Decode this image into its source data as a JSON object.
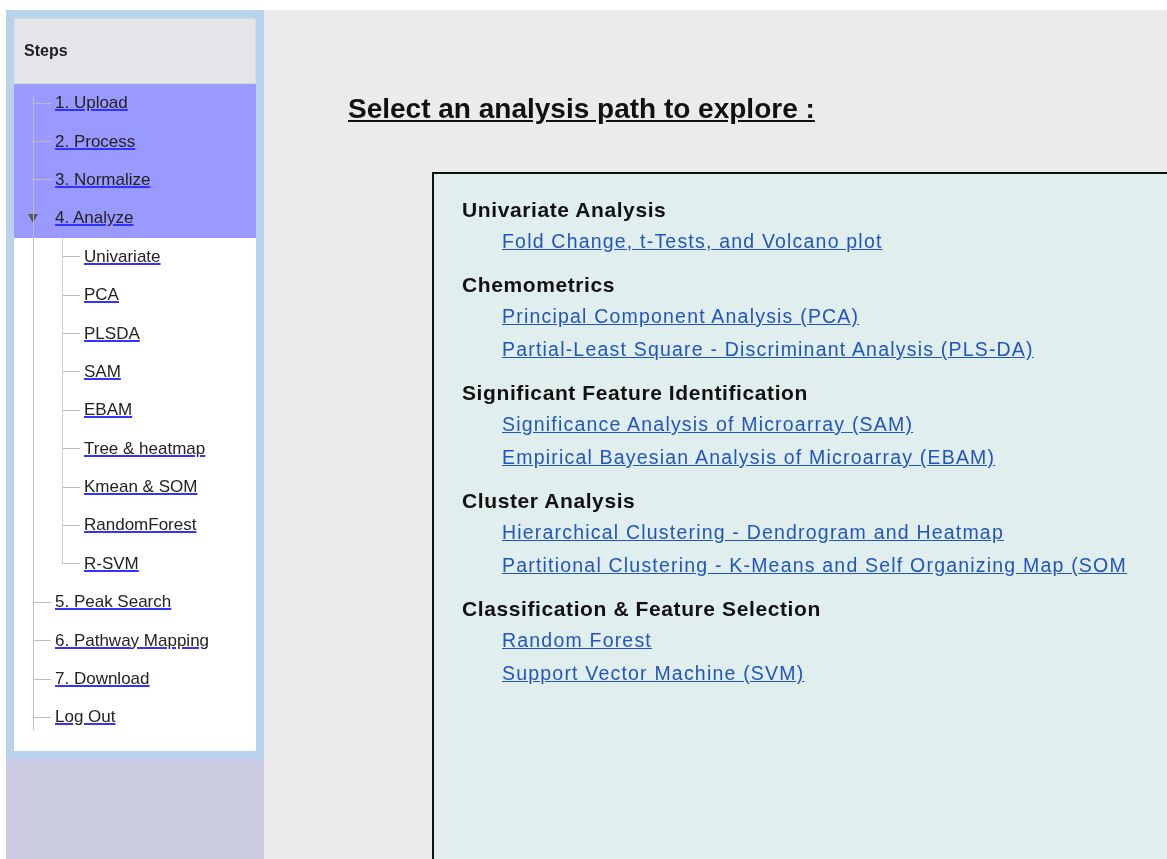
{
  "sidebar": {
    "title": "Steps",
    "items": [
      {
        "label": "1. Upload",
        "highlighted": true
      },
      {
        "label": "2. Process",
        "highlighted": true
      },
      {
        "label": "3. Normalize",
        "highlighted": true
      },
      {
        "label": "4. Analyze",
        "highlighted": true,
        "expanded": true,
        "children": [
          {
            "label": "Univariate"
          },
          {
            "label": "PCA"
          },
          {
            "label": "PLSDA"
          },
          {
            "label": "SAM"
          },
          {
            "label": "EBAM"
          },
          {
            "label": "Tree & heatmap"
          },
          {
            "label": "Kmean & SOM"
          },
          {
            "label": "RandomForest"
          },
          {
            "label": "R-SVM"
          }
        ]
      },
      {
        "label": "5. Peak Search",
        "highlighted": false
      },
      {
        "label": "6. Pathway Mapping",
        "highlighted": false
      },
      {
        "label": "7. Download",
        "highlighted": false
      },
      {
        "label": "Log Out",
        "highlighted": false
      }
    ]
  },
  "main": {
    "heading": "Select an analysis path to explore :",
    "sections": [
      {
        "title": "Univariate Analysis",
        "links": [
          "Fold Change, t-Tests, and Volcano plot"
        ]
      },
      {
        "title": "Chemometrics",
        "links": [
          "Principal Component Analysis (PCA)",
          "Partial-Least Square - Discriminant Analysis (PLS-DA)"
        ]
      },
      {
        "title": "Significant Feature Identification",
        "links": [
          "Significance Analysis of Microarray (SAM)",
          "Empirical Bayesian Analysis of Microarray (EBAM)"
        ]
      },
      {
        "title": "Cluster Analysis",
        "links": [
          "Hierarchical Clustering - Dendrogram and Heatmap",
          "Partitional Clustering - K-Means and Self Organizing Map (SOM"
        ]
      },
      {
        "title": "Classification & Feature Selection",
        "links": [
          "Random Forest",
          "Support Vector Machine (SVM)"
        ]
      }
    ]
  }
}
